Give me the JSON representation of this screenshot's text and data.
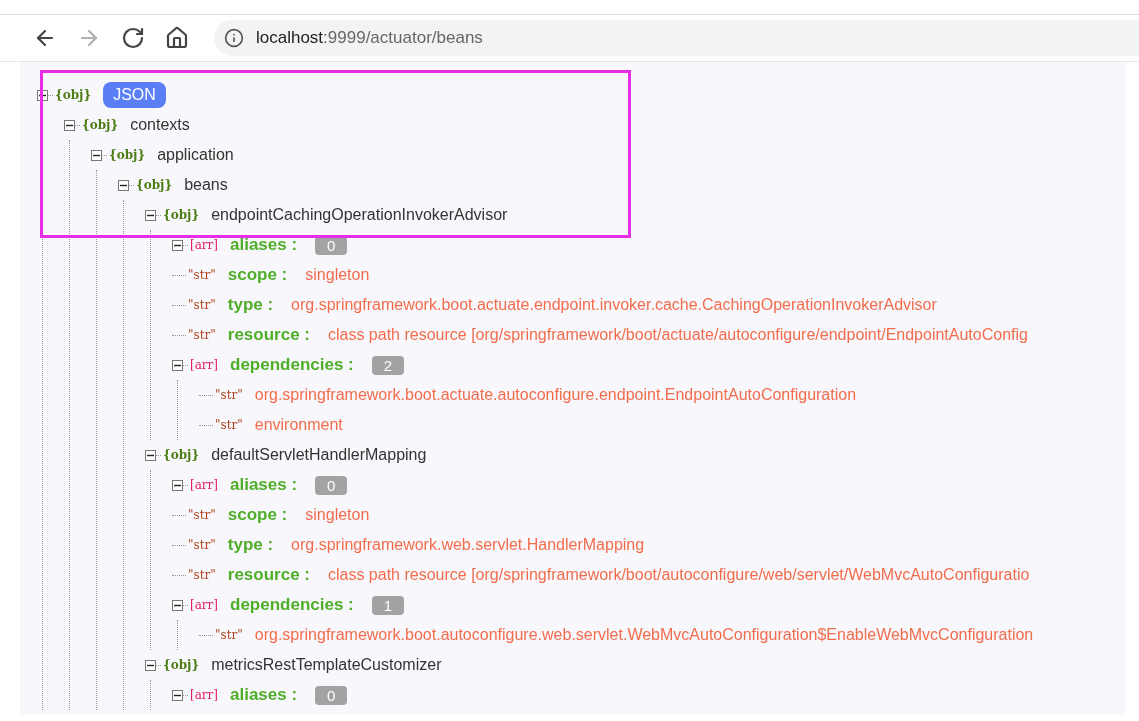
{
  "browser": {
    "nav_buttons": [
      {
        "kind": "back",
        "disabled": false
      },
      {
        "kind": "forward",
        "disabled": true
      },
      {
        "kind": "reload",
        "disabled": false
      },
      {
        "kind": "home",
        "disabled": false
      }
    ],
    "address": {
      "host": "localhost",
      "path": ":9999/actuator/beans"
    }
  },
  "tree": {
    "kind": "obj",
    "tag": "{obj}",
    "key": "JSON",
    "expanded": true,
    "children": [
      {
        "kind": "obj",
        "tag": "{obj}",
        "key": "contexts",
        "expanded": true,
        "children": [
          {
            "kind": "obj",
            "tag": "{obj}",
            "key": "application",
            "expanded": true,
            "children": [
              {
                "kind": "obj",
                "tag": "{obj}",
                "key": "beans",
                "expanded": true,
                "children": [
                  {
                    "kind": "obj",
                    "tag": "{obj}",
                    "key": "endpointCachingOperationInvokerAdvisor",
                    "expanded": true,
                    "children": [
                      {
                        "kind": "arr",
                        "tag": "[arr]",
                        "key": "aliases :",
                        "count": "0",
                        "expanded": true
                      },
                      {
                        "kind": "str",
                        "tag": "\"str\"",
                        "key": "scope :",
                        "value": "singleton"
                      },
                      {
                        "kind": "str",
                        "tag": "\"str\"",
                        "key": "type :",
                        "value": "org.springframework.boot.actuate.endpoint.invoker.cache.CachingOperationInvokerAdvisor"
                      },
                      {
                        "kind": "str",
                        "tag": "\"str\"",
                        "key": "resource :",
                        "value": "class path resource [org/springframework/boot/actuate/autoconfigure/endpoint/EndpointAutoConfig"
                      },
                      {
                        "kind": "arr",
                        "tag": "[arr]",
                        "key": "dependencies :",
                        "count": "2",
                        "expanded": true,
                        "children": [
                          {
                            "kind": "str",
                            "tag": "\"str\"",
                            "value": "org.springframework.boot.actuate.autoconfigure.endpoint.EndpointAutoConfiguration"
                          },
                          {
                            "kind": "str",
                            "tag": "\"str\"",
                            "value": "environment"
                          }
                        ]
                      }
                    ]
                  },
                  {
                    "kind": "obj",
                    "tag": "{obj}",
                    "key": "defaultServletHandlerMapping",
                    "expanded": true,
                    "children": [
                      {
                        "kind": "arr",
                        "tag": "[arr]",
                        "key": "aliases :",
                        "count": "0",
                        "expanded": true
                      },
                      {
                        "kind": "str",
                        "tag": "\"str\"",
                        "key": "scope :",
                        "value": "singleton"
                      },
                      {
                        "kind": "str",
                        "tag": "\"str\"",
                        "key": "type :",
                        "value": "org.springframework.web.servlet.HandlerMapping"
                      },
                      {
                        "kind": "str",
                        "tag": "\"str\"",
                        "key": "resource :",
                        "value": "class path resource [org/springframework/boot/autoconfigure/web/servlet/WebMvcAutoConfiguratio"
                      },
                      {
                        "kind": "arr",
                        "tag": "[arr]",
                        "key": "dependencies :",
                        "count": "1",
                        "expanded": true,
                        "children": [
                          {
                            "kind": "str",
                            "tag": "\"str\"",
                            "value": "org.springframework.boot.autoconfigure.web.servlet.WebMvcAutoConfiguration$EnableWebMvcConfiguration"
                          }
                        ]
                      }
                    ]
                  },
                  {
                    "kind": "obj",
                    "tag": "{obj}",
                    "key": "metricsRestTemplateCustomizer",
                    "expanded": true,
                    "children": [
                      {
                        "kind": "arr",
                        "tag": "[arr]",
                        "key": "aliases :",
                        "count": "0",
                        "expanded": true
                      }
                    ]
                  }
                ]
              }
            ]
          }
        ]
      }
    ]
  }
}
